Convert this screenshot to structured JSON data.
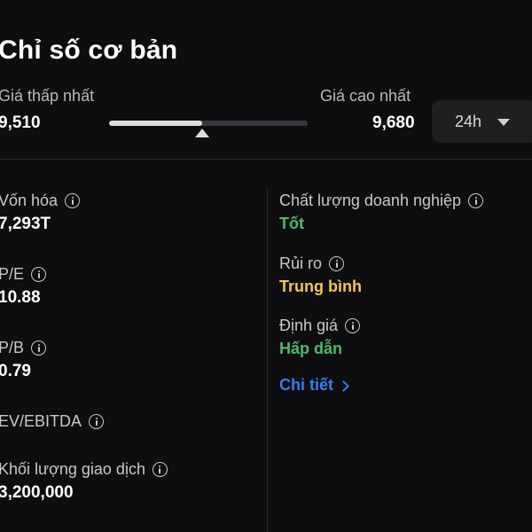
{
  "header": {
    "title": "Chỉ số cơ bản"
  },
  "price_range": {
    "low_label": "Giá thấp nhất",
    "high_label": "Giá cao nhất",
    "low_value": "9,510",
    "high_value": "9,680",
    "fill_fraction": 0.47,
    "marker_fraction": 0.47,
    "period": "24h"
  },
  "metrics": [
    {
      "label": "Vốn hóa",
      "value": "7,293T"
    },
    {
      "label": "P/E",
      "value": "10.88"
    },
    {
      "label": "P/B",
      "value": "0.79"
    },
    {
      "label": "EV/EBITDA",
      "value": ""
    },
    {
      "label": "Khối lượng giao dịch",
      "value": "3,200,000"
    }
  ],
  "ratings": [
    {
      "label": "Chất lượng doanh nghiệp",
      "value": "Tốt",
      "color": "#4cb96a"
    },
    {
      "label": "Rủi ro",
      "value": "Trung bình",
      "color": "#f3c35a"
    },
    {
      "label": "Định giá",
      "value": "Hấp dẫn",
      "color": "#4cb96a"
    }
  ],
  "detail_link": {
    "label": "Chi tiết"
  },
  "colors": {
    "background": "#0e0e10",
    "accent_link": "#3b7cf0",
    "good": "#4cb96a",
    "medium": "#f3c35a"
  }
}
